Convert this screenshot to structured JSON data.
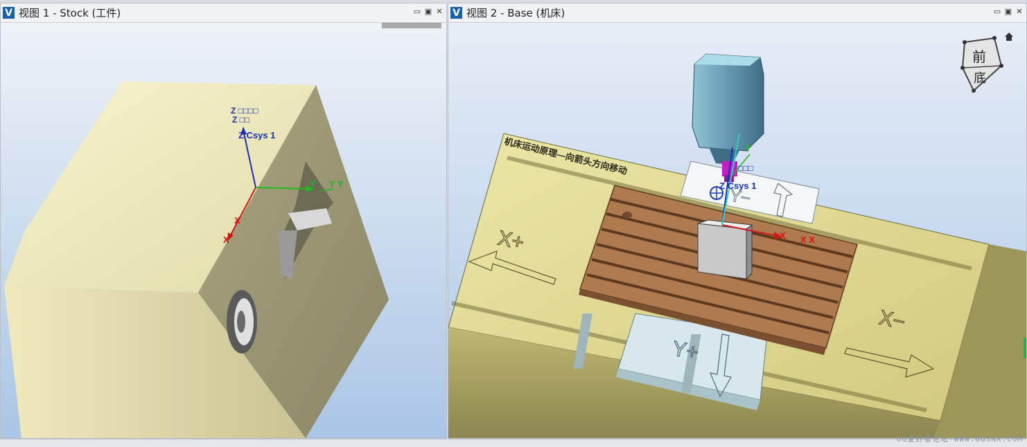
{
  "view1": {
    "title": "视图 1 - Stock (工件)",
    "labels": {
      "z_top": "Z □□□□",
      "z_mid": "Z □□",
      "z_csys": "Z Csys 1",
      "y_axis": "Y",
      "y_axis2": "Y Y",
      "x_axis": "X",
      "x_axis2": "X"
    }
  },
  "view2": {
    "title": "视图 2 - Base (机床)",
    "banner": "机床运动原理—向箭头方向移动",
    "labels": {
      "x_plus": "X+",
      "x_minus": "X−",
      "y_plus": "Y+",
      "y_minus": "Y−",
      "z_csys": "Z Csys 1",
      "y_axis": "Y",
      "spindle_label": "□□□",
      "x_axis": "X",
      "x_axis2": "X X"
    },
    "view_cube": {
      "top_face": "前",
      "bottom_face": "底"
    }
  },
  "window_buttons": {
    "minimize": "▭",
    "restore": "▣",
    "close": "✕"
  },
  "watermark": "UG爱好者论坛-WWW.UGSNX.COM",
  "colors": {
    "background_gradient_top": "#e6edf6",
    "background_gradient_bottom": "#aac6e6",
    "stock_face_light": "#f3f0c8",
    "base_yellow": "#d6cf84",
    "table_wood": "#a8744c",
    "spindle_blue": "#6ba7bf"
  }
}
